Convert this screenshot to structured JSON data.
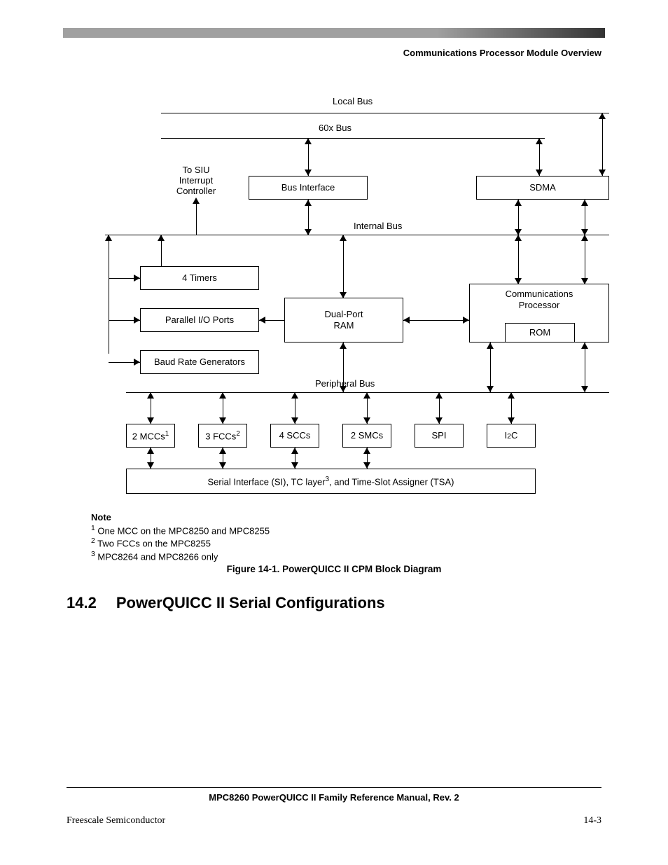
{
  "header": {
    "title": "Communications Processor Module Overview"
  },
  "diagram": {
    "labels": {
      "local_bus": "Local Bus",
      "bus_60x": "60x Bus",
      "internal_bus": "Internal Bus",
      "peripheral_bus": "Peripheral Bus",
      "to_siu_l1": "To SIU",
      "to_siu_l2": "Interrupt",
      "to_siu_l3": "Controller"
    },
    "boxes": {
      "bus_interface": "Bus Interface",
      "sdma": "SDMA",
      "timers": "4 Timers",
      "pio": "Parallel I/O Ports",
      "brg": "Baud Rate Generators",
      "dpr_l1": "Dual-Port",
      "dpr_l2": "RAM",
      "cp_l1": "Communications",
      "cp_l2": "Processor",
      "rom": "ROM",
      "mcc": "2 MCCs",
      "fcc": "3 FCCs",
      "scc": "4 SCCs",
      "smc": "2 SMCs",
      "spi": "SPI",
      "i2c_i": "I",
      "i2c_2": "2",
      "i2c_c": "C",
      "si_box_pre": "Serial Interface (SI), TC layer",
      "si_box_post": ", and Time-Slot Assigner (TSA)"
    }
  },
  "notes": {
    "label": "Note",
    "n1": " One MCC on the MPC8250 and MPC8255",
    "n2": " Two FCCs on the MPC8255",
    "n3": " MPC8264 and MPC8266 only"
  },
  "figure_caption": "Figure 14-1. PowerQUICC II CPM Block Diagram",
  "section": {
    "number": "14.2",
    "title": "PowerQUICC II Serial Configurations"
  },
  "footer": {
    "manual_title": "MPC8260 PowerQUICC II Family Reference Manual, Rev. 2",
    "left": "Freescale Semiconductor",
    "right": "14-3"
  }
}
